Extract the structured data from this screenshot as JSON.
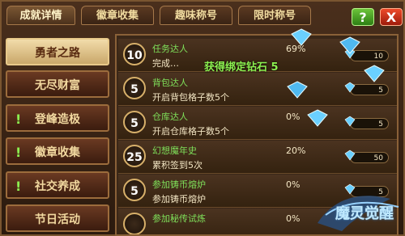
{
  "tabs": [
    "成就详情",
    "徽章收集",
    "趣味称号",
    "限时称号"
  ],
  "buttons": {
    "help": "?",
    "close": "X"
  },
  "sidebar": [
    {
      "label": "勇者之路",
      "alert": false
    },
    {
      "label": "无尽财富",
      "alert": false
    },
    {
      "label": "登峰造极",
      "alert": true
    },
    {
      "label": "徽章收集",
      "alert": true
    },
    {
      "label": "社交养成",
      "alert": true
    },
    {
      "label": "节日活动",
      "alert": false
    }
  ],
  "overlay": "获得绑定钻石 5",
  "achievements": [
    {
      "level": "10",
      "title": "任务达人",
      "desc": "完成…",
      "percent": "69%",
      "reward": "10"
    },
    {
      "level": "5",
      "title": "背包达人",
      "desc": "开启背包格子数5个",
      "percent": "",
      "reward": "5"
    },
    {
      "level": "5",
      "title": "仓库达人",
      "desc": "开启仓库格子数5个",
      "percent": "0%",
      "reward": "5"
    },
    {
      "level": "25",
      "title": "幻想魔年史",
      "desc": "累积签到5次",
      "percent": "20%",
      "reward": "50"
    },
    {
      "level": "5",
      "title": "参加铸币熔炉",
      "desc": "参加铸币熔炉",
      "percent": "0%",
      "reward": "5"
    },
    {
      "level": "",
      "title": "参加秘传试炼",
      "desc": "",
      "percent": "0%",
      "reward": ""
    }
  ],
  "logo": "魔灵觉醒",
  "colors": {
    "accent_green": "#8cf050",
    "gold": "#d7b06a"
  }
}
